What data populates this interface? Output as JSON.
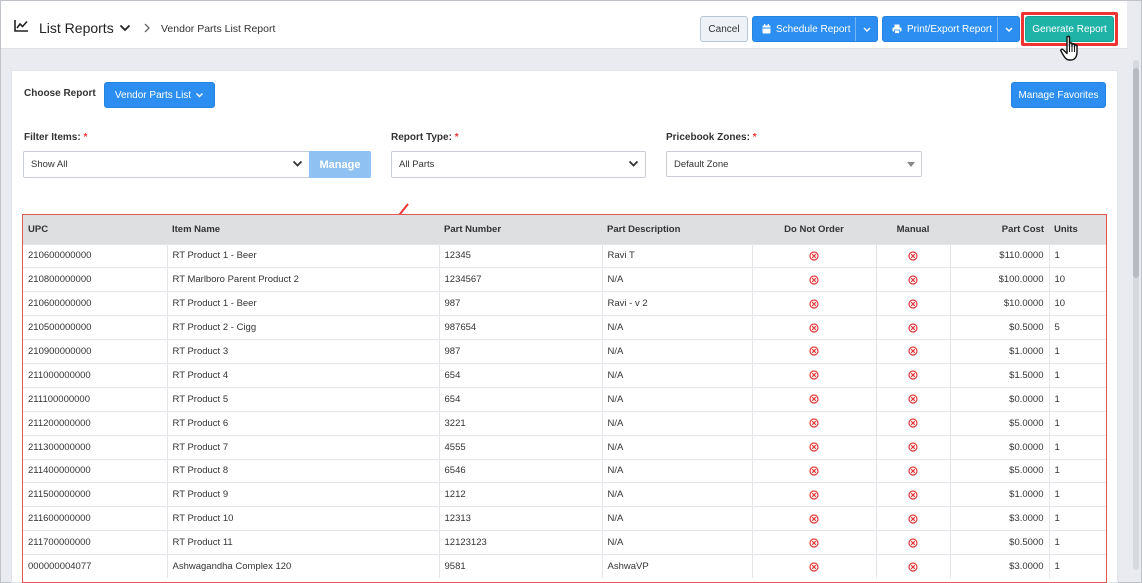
{
  "header": {
    "title": "List Reports",
    "current_report": "Vendor Parts List Report",
    "cancel_label": "Cancel",
    "schedule_label": "Schedule Report",
    "print_label": "Print/Export Report",
    "generate_label": "Generate Report"
  },
  "report_bar": {
    "choose_label": "Choose Report",
    "selected_report": "Vendor Parts List",
    "favorites_label": "Manage Favorites"
  },
  "filters": {
    "filter_items_label": "Filter Items:",
    "filter_items_value": "Show All",
    "manage_label": "Manage",
    "report_type_label": "Report Type:",
    "report_type_value": "All Parts",
    "pricebook_label": "Pricebook Zones:",
    "pricebook_value": "Default Zone",
    "required_mark": "*"
  },
  "table": {
    "columns": [
      "UPC",
      "Item Name",
      "Part Number",
      "Part Description",
      "Do Not Order",
      "Manual",
      "Part Cost",
      "Units"
    ],
    "rows": [
      {
        "upc": "210600000000",
        "name": "RT Product 1 - Beer",
        "part": "12345",
        "desc": "Ravi T",
        "cost": "$110.0000",
        "units": "1"
      },
      {
        "upc": "210800000000",
        "name": "RT Marlboro Parent Product 2",
        "part": "1234567",
        "desc": "N/A",
        "cost": "$100.0000",
        "units": "10"
      },
      {
        "upc": "210600000000",
        "name": "RT Product 1 - Beer",
        "part": "987",
        "desc": "Ravi - v 2",
        "cost": "$10.0000",
        "units": "10"
      },
      {
        "upc": "210500000000",
        "name": "RT Product 2 - Cigg",
        "part": "987654",
        "desc": "N/A",
        "cost": "$0.5000",
        "units": "5"
      },
      {
        "upc": "210900000000",
        "name": "RT Product 3",
        "part": "987",
        "desc": "N/A",
        "cost": "$1.0000",
        "units": "1"
      },
      {
        "upc": "211000000000",
        "name": "RT Product 4",
        "part": "654",
        "desc": "N/A",
        "cost": "$1.5000",
        "units": "1"
      },
      {
        "upc": "211100000000",
        "name": "RT Product 5",
        "part": "654",
        "desc": "N/A",
        "cost": "$0.0000",
        "units": "1"
      },
      {
        "upc": "211200000000",
        "name": "RT Product 6",
        "part": "3221",
        "desc": "N/A",
        "cost": "$5.0000",
        "units": "1"
      },
      {
        "upc": "211300000000",
        "name": "RT Product 7",
        "part": "4555",
        "desc": "N/A",
        "cost": "$0.0000",
        "units": "1"
      },
      {
        "upc": "211400000000",
        "name": "RT Product 8",
        "part": "6546",
        "desc": "N/A",
        "cost": "$5.0000",
        "units": "1"
      },
      {
        "upc": "211500000000",
        "name": "RT Product 9",
        "part": "1212",
        "desc": "N/A",
        "cost": "$1.0000",
        "units": "1"
      },
      {
        "upc": "211600000000",
        "name": "RT Product 10",
        "part": "12313",
        "desc": "N/A",
        "cost": "$3.0000",
        "units": "1"
      },
      {
        "upc": "211700000000",
        "name": "RT Product 11",
        "part": "12123123",
        "desc": "N/A",
        "cost": "$0.5000",
        "units": "1"
      },
      {
        "upc": "000000004077",
        "name": "Ashwagandha Complex 120",
        "part": "9581",
        "desc": "AshwaVP",
        "cost": "$3.0000",
        "units": "1"
      }
    ]
  },
  "colors": {
    "primary": "#2b8ef0",
    "generate": "#1fb3a7",
    "highlight": "#e33333",
    "status_x": "#e03a3a"
  },
  "icons": {
    "header": "line-chart-icon",
    "schedule": "calendar-icon",
    "print": "printer-icon",
    "status": "x-circle-icon",
    "cursor": "hand-pointer-icon"
  }
}
